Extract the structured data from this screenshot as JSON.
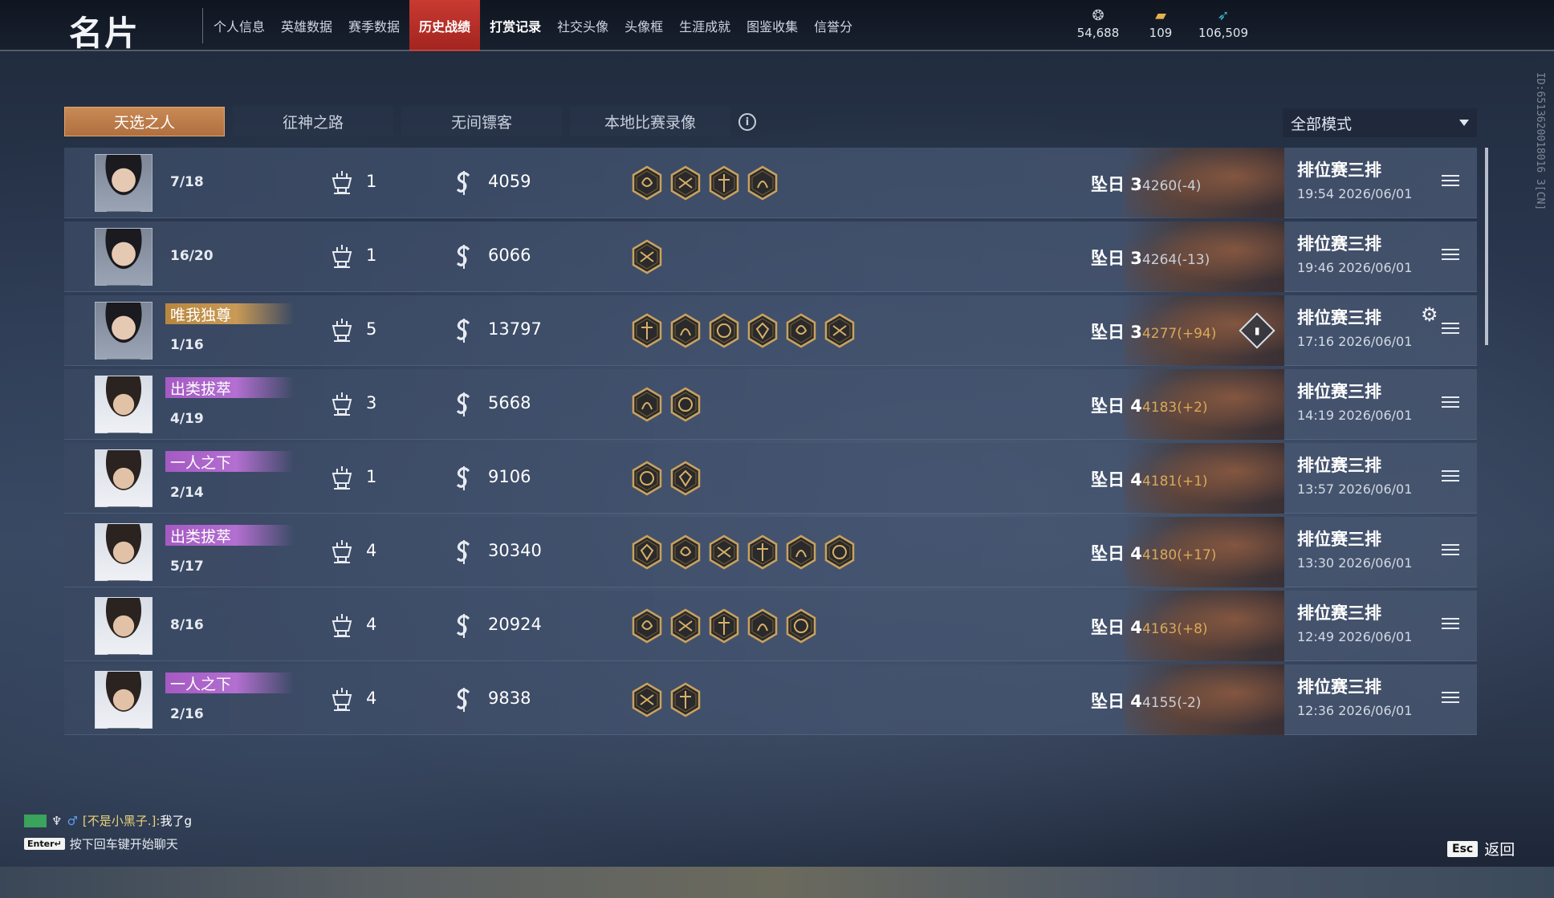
{
  "header": {
    "title": "名片",
    "tabs": [
      {
        "label": "个人信息",
        "state": "normal"
      },
      {
        "label": "英雄数据",
        "state": "normal"
      },
      {
        "label": "赛季数据",
        "state": "normal"
      },
      {
        "label": "历史战绩",
        "state": "active"
      },
      {
        "label": "打赏记录",
        "state": "bold"
      },
      {
        "label": "社交头像",
        "state": "normal"
      },
      {
        "label": "头像框",
        "state": "normal"
      },
      {
        "label": "生涯成就",
        "state": "normal"
      },
      {
        "label": "图鉴收集",
        "state": "normal"
      },
      {
        "label": "信誉分",
        "state": "normal"
      }
    ],
    "currencies": [
      {
        "icon": "coin-stack-icon",
        "value": "54,688",
        "color": "#c8cdd6"
      },
      {
        "icon": "gold-ticket-icon",
        "value": "109",
        "color": "#e8b24a"
      },
      {
        "icon": "feather-icon",
        "value": "106,509",
        "color": "#3fb3c9"
      }
    ]
  },
  "side_id": "ID:6513620018016 3[CN]",
  "subtabs": [
    {
      "label": "天选之人",
      "active": true
    },
    {
      "label": "征神之路",
      "active": false
    },
    {
      "label": "无间镖客",
      "active": false
    },
    {
      "label": "本地比赛录像",
      "active": false
    }
  ],
  "mode_select": {
    "value": "全部模式"
  },
  "matches": [
    {
      "avatar": "a",
      "title": "",
      "title_color": "",
      "placement": "7/18",
      "trophies": "1",
      "coins": "4059",
      "badges": 4,
      "rank": "坠日 3",
      "score": "4260(-4)",
      "score_sign": "neg",
      "mode": "排位赛三排",
      "time": "19:54  2026/06/01",
      "chart": false,
      "gear": false
    },
    {
      "avatar": "a",
      "title": "",
      "title_color": "",
      "placement": "16/20",
      "trophies": "1",
      "coins": "6066",
      "badges": 1,
      "rank": "坠日 3",
      "score": "4264(-13)",
      "score_sign": "neg",
      "mode": "排位赛三排",
      "time": "19:46  2026/06/01",
      "chart": false,
      "gear": false
    },
    {
      "avatar": "a",
      "title": "唯我独尊",
      "title_color": "gold",
      "placement": "1/16",
      "trophies": "5",
      "coins": "13797",
      "badges": 6,
      "rank": "坠日 3",
      "score": "4277(+94)",
      "score_sign": "pos",
      "mode": "排位赛三排",
      "time": "17:16  2026/06/01",
      "chart": true,
      "gear": true
    },
    {
      "avatar": "b",
      "title": "出类拔萃",
      "title_color": "purple",
      "placement": "4/19",
      "trophies": "3",
      "coins": "5668",
      "badges": 2,
      "rank": "坠日 4",
      "score": "4183(+2)",
      "score_sign": "pos",
      "mode": "排位赛三排",
      "time": "14:19  2026/06/01",
      "chart": false,
      "gear": false
    },
    {
      "avatar": "b",
      "title": "一人之下",
      "title_color": "purple",
      "placement": "2/14",
      "trophies": "1",
      "coins": "9106",
      "badges": 2,
      "rank": "坠日 4",
      "score": "4181(+1)",
      "score_sign": "pos",
      "mode": "排位赛三排",
      "time": "13:57  2026/06/01",
      "chart": false,
      "gear": false
    },
    {
      "avatar": "b",
      "title": "出类拔萃",
      "title_color": "purple",
      "placement": "5/17",
      "trophies": "4",
      "coins": "30340",
      "badges": 6,
      "rank": "坠日 4",
      "score": "4180(+17)",
      "score_sign": "pos",
      "mode": "排位赛三排",
      "time": "13:30  2026/06/01",
      "chart": false,
      "gear": false
    },
    {
      "avatar": "b",
      "title": "",
      "title_color": "",
      "placement": "8/16",
      "trophies": "4",
      "coins": "20924",
      "badges": 5,
      "rank": "坠日 4",
      "score": "4163(+8)",
      "score_sign": "pos",
      "mode": "排位赛三排",
      "time": "12:49  2026/06/01",
      "chart": false,
      "gear": false
    },
    {
      "avatar": "b",
      "title": "一人之下",
      "title_color": "purple",
      "placement": "2/16",
      "trophies": "4",
      "coins": "9838",
      "badges": 2,
      "rank": "坠日 4",
      "score": "4155(-2)",
      "score_sign": "neg",
      "mode": "排位赛三排",
      "time": "12:36  2026/06/01",
      "chart": false,
      "gear": false
    }
  ],
  "chat": {
    "message_user": "[不是小黑子.]:",
    "message_text": "我了g",
    "hint": "按下回车键开始聊天",
    "enter_key": "Enter↵"
  },
  "footer": {
    "esc_key": "Esc",
    "back_label": "返回"
  }
}
